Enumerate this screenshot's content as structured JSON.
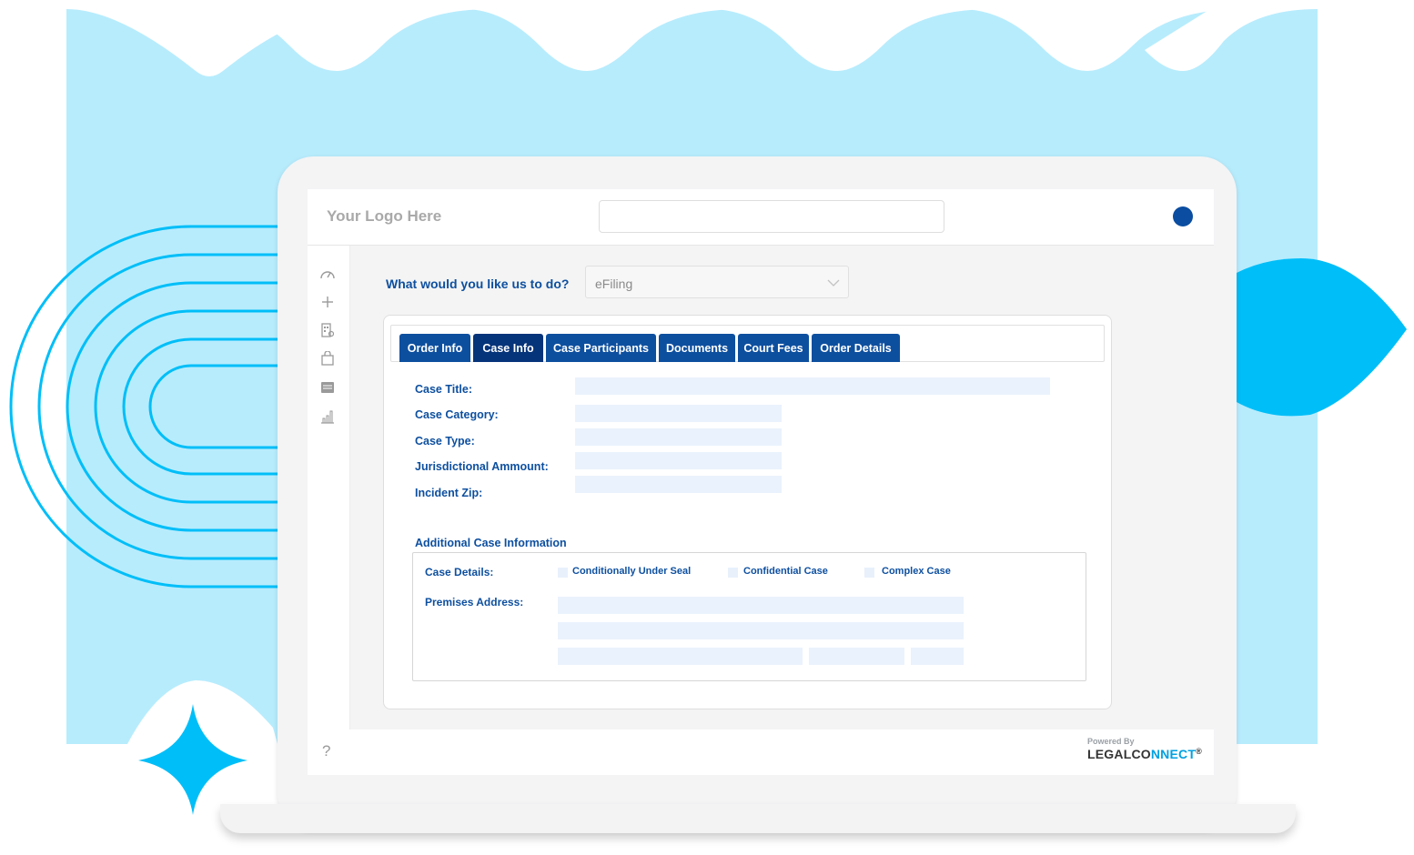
{
  "header": {
    "logo_text": "Your Logo Here",
    "search_value": ""
  },
  "sidebar": {
    "icons": [
      "speedometer-icon",
      "plus-icon",
      "building-icon",
      "shopping-bag-icon",
      "list-icon",
      "bar-chart-icon"
    ]
  },
  "question": {
    "label": "What would you like us to do?",
    "selected": "eFiling"
  },
  "tabs": [
    {
      "label": "Order Info"
    },
    {
      "label": "Case Info"
    },
    {
      "label": "Case Participants"
    },
    {
      "label": "Documents"
    },
    {
      "label": "Court Fees"
    },
    {
      "label": "Order Details"
    }
  ],
  "active_tab": "Case Info",
  "case_info": {
    "fields": [
      {
        "label": "Case Title:",
        "value": ""
      },
      {
        "label": "Case Category:",
        "value": ""
      },
      {
        "label": "Case Type:",
        "value": ""
      },
      {
        "label": "Jurisdictional Ammount:",
        "value": ""
      },
      {
        "label": "Incident Zip:",
        "value": ""
      }
    ],
    "additional_title": "Additional Case Information",
    "case_details_label": "Case Details:",
    "checkboxes": [
      {
        "label": "Conditionally Under Seal",
        "checked": false
      },
      {
        "label": "Confidential Case",
        "checked": false
      },
      {
        "label": "Complex Case",
        "checked": false
      }
    ],
    "premises_label": "Premises Address:"
  },
  "footer": {
    "help": "?",
    "powered_by": "Powered By",
    "brand_part1": "LEGALCO",
    "brand_part2": "NNECT",
    "brand_mark": "®"
  },
  "colors": {
    "brand_blue": "#0d4f9f",
    "active_tab": "#06347a",
    "field_fill": "#eaf2fd",
    "decor_light": "#b7ecfd",
    "decor_bright": "#00bef8"
  }
}
